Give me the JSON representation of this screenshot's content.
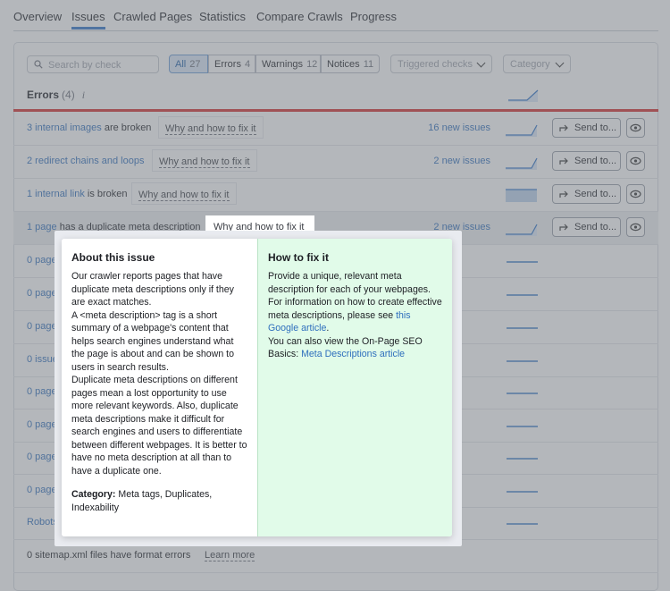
{
  "nav": {
    "tabs": [
      "Overview",
      "Issues",
      "Crawled Pages",
      "Statistics",
      "Compare Crawls",
      "Progress"
    ],
    "active": "Issues"
  },
  "toolbar": {
    "search_placeholder": "Search by check",
    "filters": [
      {
        "label": "All",
        "count": "27"
      },
      {
        "label": "Errors",
        "count": "4"
      },
      {
        "label": "Warnings",
        "count": "12"
      },
      {
        "label": "Notices",
        "count": "11"
      }
    ],
    "triggered_label": "Triggered checks",
    "category_label": "Category"
  },
  "section": {
    "title": "Errors",
    "count": "(4)",
    "info_icon": "i"
  },
  "rows": [
    {
      "link": "3 internal images",
      "rest": " are broken",
      "fix": "Why and how to fix it",
      "new_issues": "16 new issues"
    },
    {
      "link": "2 redirect chains and loops",
      "rest": "",
      "fix": "Why and how to fix it",
      "new_issues": "2 new issues"
    },
    {
      "link": "1 internal link",
      "rest": " is broken",
      "fix": "Why and how to fix it",
      "new_issues": ""
    },
    {
      "link": "1 page",
      "rest": " has a duplicate meta description",
      "fix": "Why and how to fix it",
      "new_issues": "2 new issues"
    }
  ],
  "send_label": "Send to...",
  "bg_rows": [
    {
      "text": "0 pages"
    },
    {
      "text": "0 pages"
    },
    {
      "text": "0 pages"
    },
    {
      "text": "0 issues"
    },
    {
      "text": "0 pages"
    },
    {
      "text": "0 pages"
    },
    {
      "text": "0 pages"
    },
    {
      "text": "0 pages"
    },
    {
      "text": "Robots.t"
    },
    {
      "text": "0 sitemap.xml files have format errors",
      "learn": "Learn more"
    }
  ],
  "popover": {
    "about_title": "About this issue",
    "about_p1": "Our crawler reports pages that have duplicate meta descriptions only if they are exact matches.",
    "about_p2": "A <meta description> tag is a short summary of a webpage's content that helps search engines understand what the page is about and can be shown to users in search results.",
    "about_p3": "Duplicate meta descriptions on different pages mean a lost opportunity to use more relevant keywords. Also, duplicate meta descriptions make it difficult for search engines and users to differentiate between different webpages. It is better to have no meta description at all than to have a duplicate one.",
    "category_label": "Category:",
    "category_value": " Meta tags, Duplicates, Indexability",
    "fix_title": "How to fix it",
    "fix_p1": "Provide a unique, relevant meta description for each of your webpages. For information on how to create effective meta descriptions, please see ",
    "fix_link1": "this Google article",
    "fix_p1_end": ".",
    "fix_p2": "You can also view the On-Page SEO Basics: ",
    "fix_link2": "Meta Descriptions article"
  },
  "colors": {
    "accent": "#2f74c9",
    "error": "#d62b2b",
    "fix_bg": "#e1fbe9"
  }
}
